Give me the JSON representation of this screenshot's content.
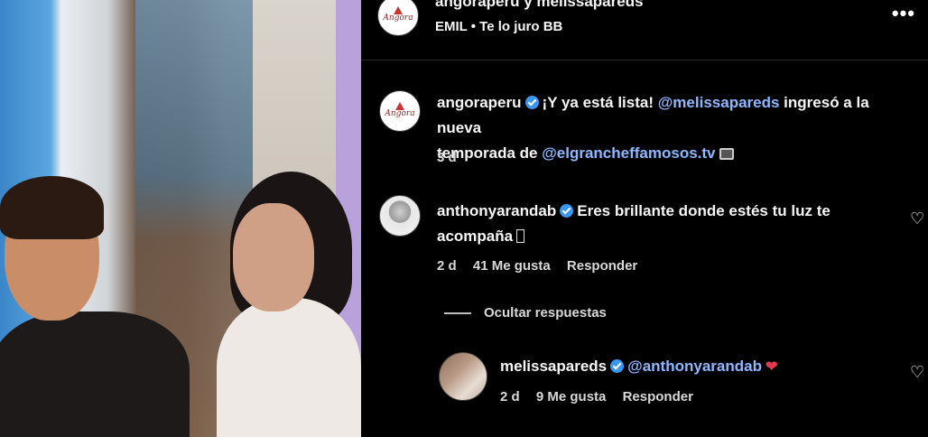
{
  "post": {
    "title": "angoraperu y melissapareds",
    "audio": "EMIL • Te lo juro BB",
    "more_icon": "more-icon"
  },
  "caption": {
    "username": "angoraperu",
    "text_start": "¡Y ya está lista! ",
    "mention1": "@melissapareds",
    "text_mid": " ingresó a la nueva",
    "text_line2": "temporada de ",
    "mention2": "@elgrancheffamosos.tv",
    "time": "3 d"
  },
  "comments": [
    {
      "username": "anthonyarandab",
      "text_line1": "Eres brillante donde estés tu luz te",
      "text_line2": "acompaña",
      "time": "2 d",
      "likes": "41 Me gusta",
      "reply": "Responder"
    }
  ],
  "replies_toggle": "Ocultar respuestas",
  "reply": {
    "username": "melissapareds",
    "mention": "@anthonyarandab",
    "time": "2 d",
    "likes": "9 Me gusta",
    "reply": "Responder"
  },
  "avatar_logo_text": "Angora",
  "colors": {
    "mention": "#8eb7ff",
    "verified": "#3897f0",
    "heart": "#e23a52"
  }
}
